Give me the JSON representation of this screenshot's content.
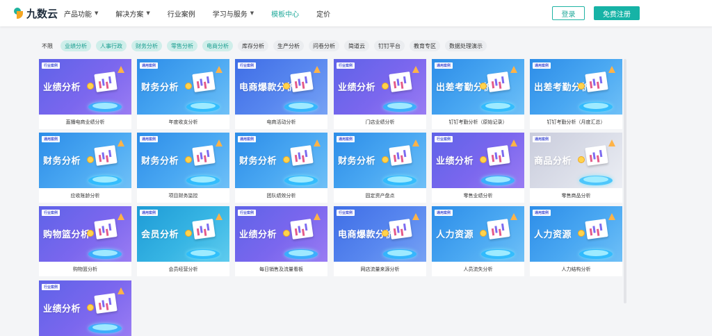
{
  "brand": {
    "name": "九数云"
  },
  "nav": [
    {
      "label": "产品功能",
      "caret": true,
      "active": false
    },
    {
      "label": "解决方案",
      "caret": true,
      "active": false
    },
    {
      "label": "行业案例",
      "caret": false,
      "active": false
    },
    {
      "label": "学习与服务",
      "caret": true,
      "active": false
    },
    {
      "label": "模板中心",
      "caret": false,
      "active": true
    },
    {
      "label": "定价",
      "caret": false,
      "active": false
    }
  ],
  "header": {
    "login_label": "登录",
    "register_label": "免费注册"
  },
  "filters": [
    {
      "label": "不限",
      "style": "plain"
    },
    {
      "label": "业绩分析",
      "style": "sel"
    },
    {
      "label": "人事行政",
      "style": "sel"
    },
    {
      "label": "财务分析",
      "style": "sel"
    },
    {
      "label": "零售分析",
      "style": "sel"
    },
    {
      "label": "电商分析",
      "style": "sel"
    },
    {
      "label": "库存分析",
      "style": "normal"
    },
    {
      "label": "生产分析",
      "style": "normal"
    },
    {
      "label": "问卷分析",
      "style": "normal"
    },
    {
      "label": "简道云",
      "style": "normal"
    },
    {
      "label": "钉钉平台",
      "style": "normal"
    },
    {
      "label": "教育专区",
      "style": "normal"
    },
    {
      "label": "数据处理演示",
      "style": "normal"
    }
  ],
  "cards": [
    {
      "tag": "行业案例",
      "banner_title": "业绩分析",
      "caption": "直播电商业绩分析",
      "theme": "purple"
    },
    {
      "tag": "通用案例",
      "banner_title": "财务分析",
      "caption": "年度收支分析",
      "theme": "blue"
    },
    {
      "tag": "行业案例",
      "banner_title": "电商爆款分析",
      "caption": "电商活动分析",
      "theme": "indigo"
    },
    {
      "tag": "行业案例",
      "banner_title": "业绩分析",
      "caption": "门店业绩分析",
      "theme": "purple"
    },
    {
      "tag": "通用案例",
      "banner_title": "出差考勤分析",
      "caption": "钉钉考勤分析（原始记录）",
      "theme": "blue"
    },
    {
      "tag": "通用案例",
      "banner_title": "出差考勤分析",
      "caption": "钉钉考勤分析（月度汇总）",
      "theme": "blue"
    },
    {
      "tag": "通用案例",
      "banner_title": "财务分析",
      "caption": "应收账龄分析",
      "theme": "blue"
    },
    {
      "tag": "通用案例",
      "banner_title": "财务分析",
      "caption": "项目财务监控",
      "theme": "blue"
    },
    {
      "tag": "通用案例",
      "banner_title": "财务分析",
      "caption": "团队绩效分析",
      "theme": "blue"
    },
    {
      "tag": "通用案例",
      "banner_title": "财务分析",
      "caption": "固定资产盘点",
      "theme": "blue"
    },
    {
      "tag": "行业案例",
      "banner_title": "业绩分析",
      "caption": "零售业绩分析",
      "theme": "purple"
    },
    {
      "tag": "通用案例",
      "banner_title": "商品分析",
      "caption": "零售商品分析",
      "theme": "gray"
    },
    {
      "tag": "行业案例",
      "banner_title": "购物篮分析",
      "caption": "购物篮分析",
      "theme": "purple"
    },
    {
      "tag": "通用案例",
      "banner_title": "会员分析",
      "caption": "会员经营分析",
      "theme": "teal"
    },
    {
      "tag": "行业案例",
      "banner_title": "业绩分析",
      "caption": "每日销售及流量看板",
      "theme": "purple"
    },
    {
      "tag": "行业案例",
      "banner_title": "电商爆款分析",
      "caption": "网店流量来源分析",
      "theme": "indigo"
    },
    {
      "tag": "通用案例",
      "banner_title": "人力资源",
      "caption": "人员流失分析",
      "theme": "blue"
    },
    {
      "tag": "通用案例",
      "banner_title": "人力资源",
      "caption": "人力结构分析",
      "theme": "blue"
    },
    {
      "tag": "行业案例",
      "banner_title": "业绩分析",
      "caption": "",
      "theme": "purple"
    }
  ]
}
